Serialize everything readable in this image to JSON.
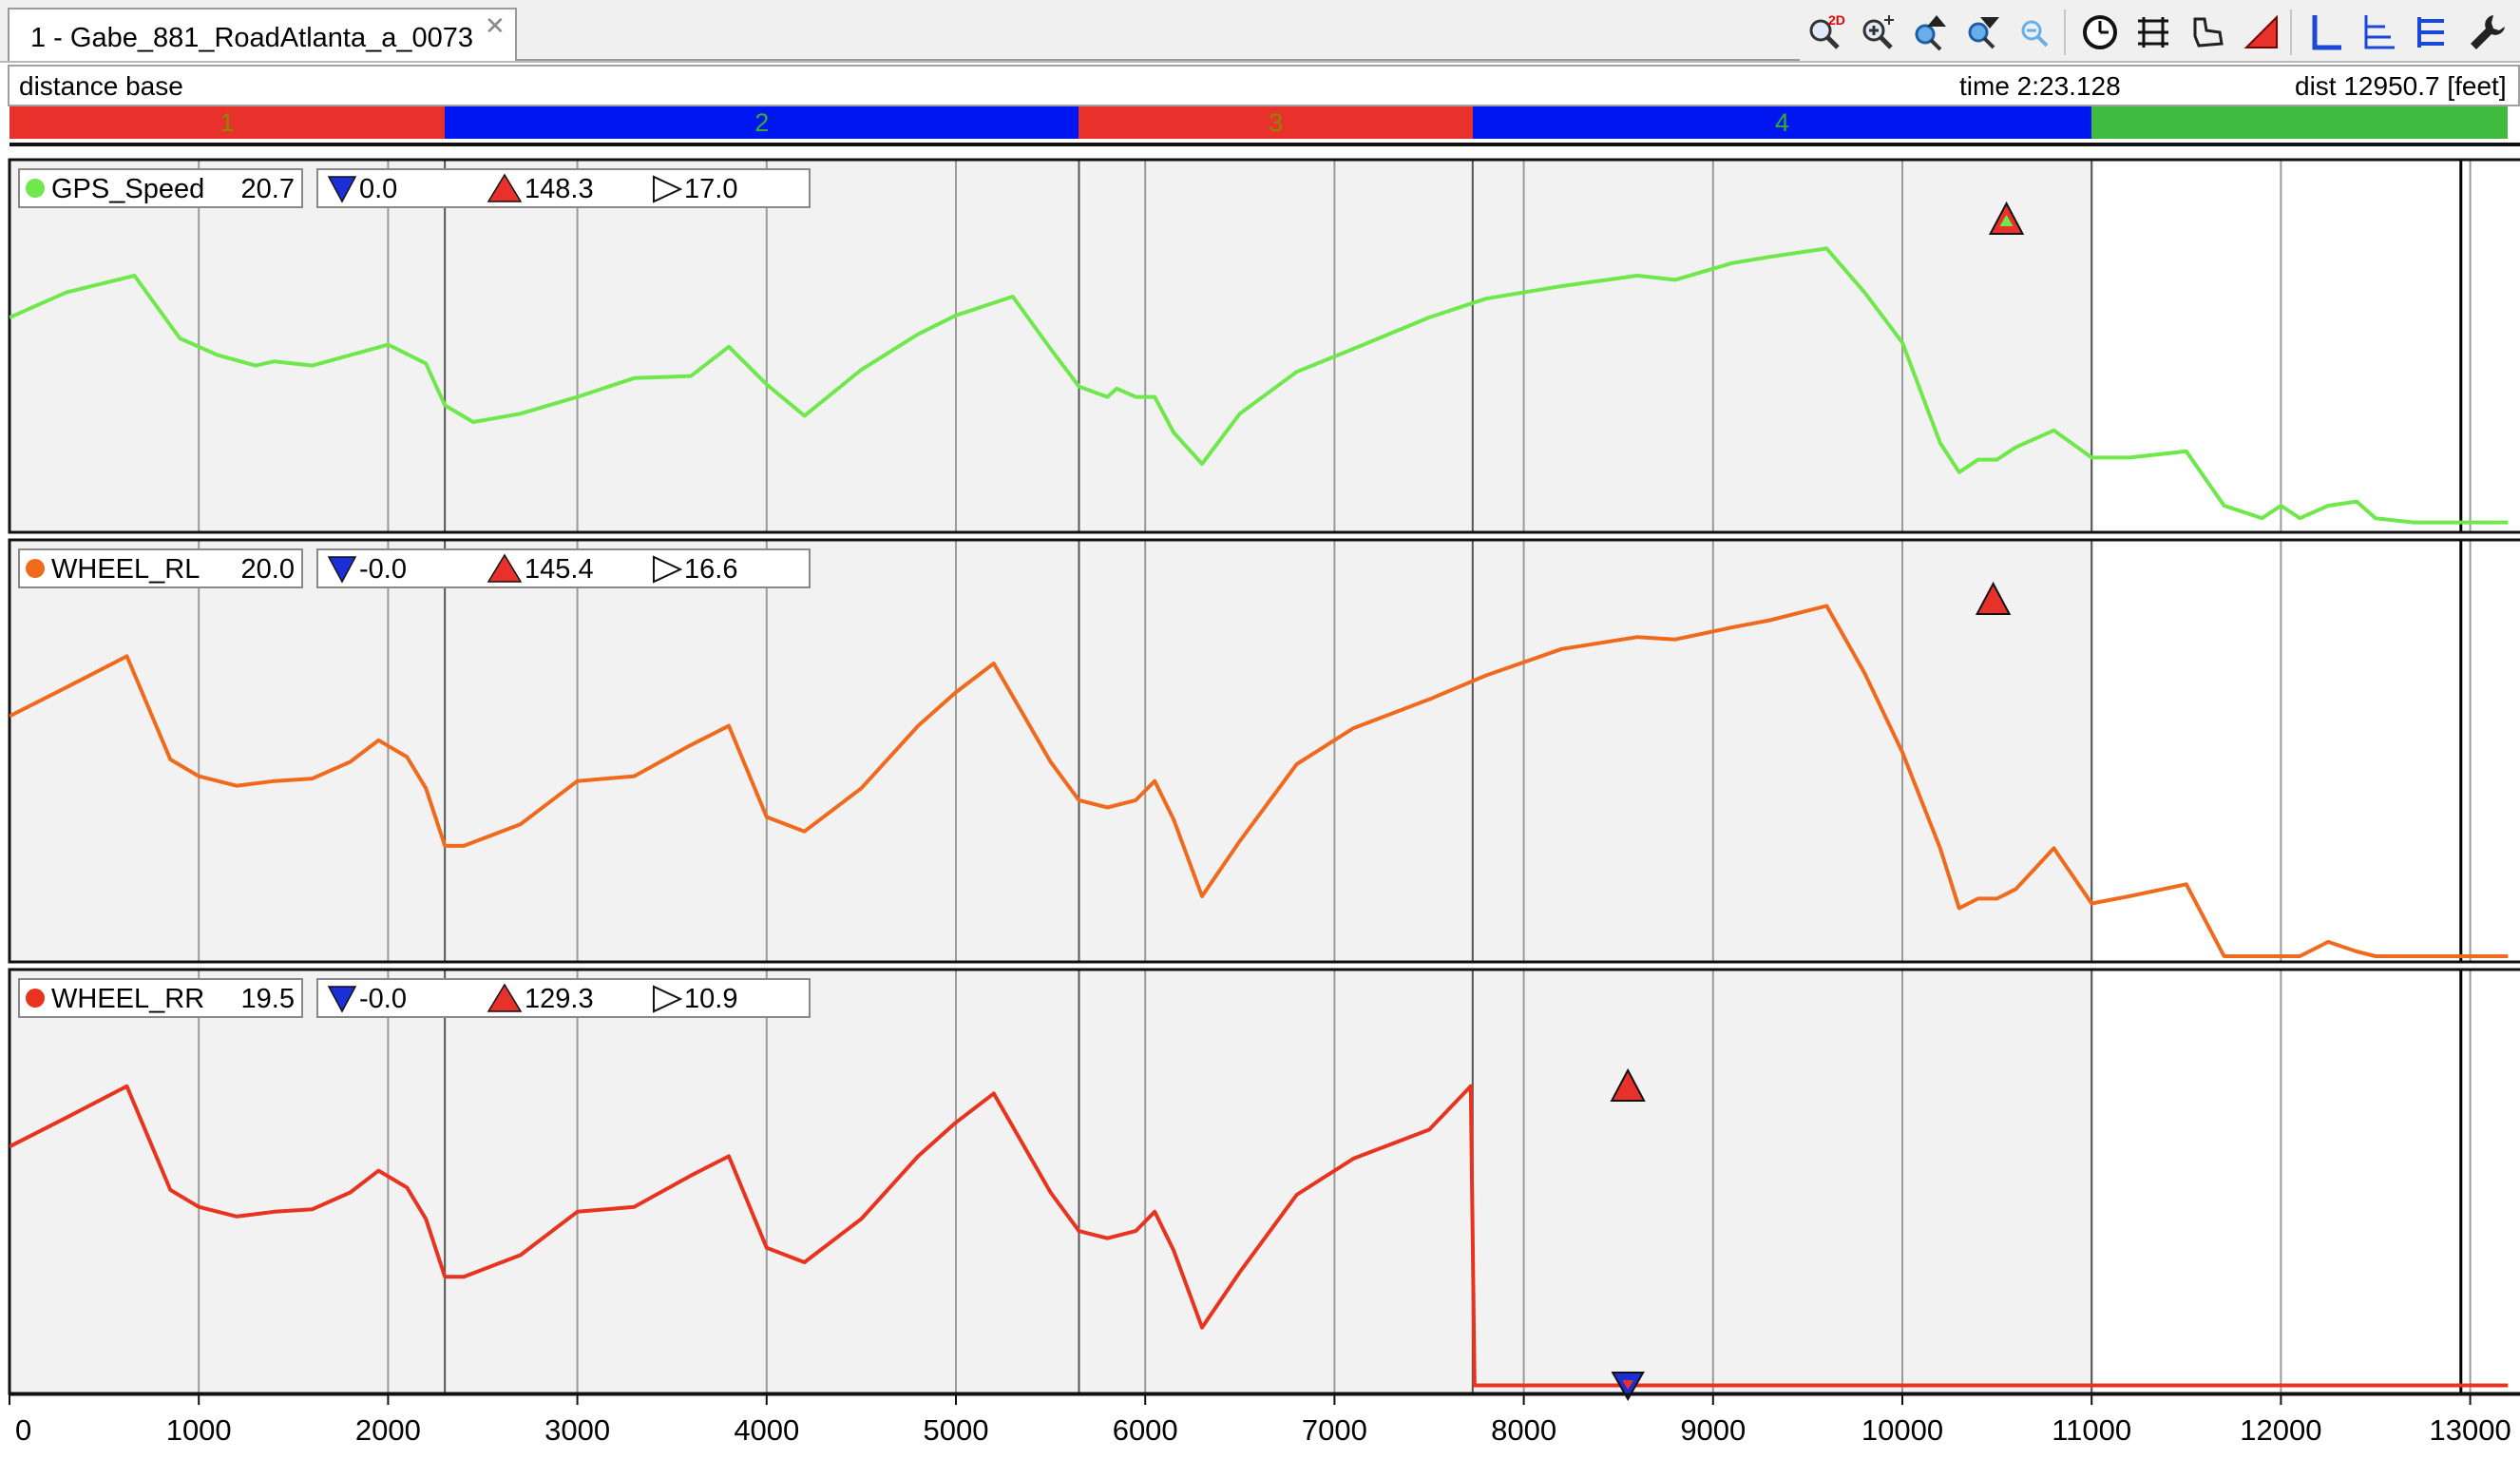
{
  "tab": {
    "title": "1 - Gabe_881_RoadAtlanta_a_0073",
    "close_glyph": "✕"
  },
  "toolbar": {
    "buttons": [
      {
        "icon": "zoom-2d-icon"
      },
      {
        "icon": "zoom-in-icon"
      },
      {
        "icon": "zoom-up-icon"
      },
      {
        "icon": "zoom-down-icon"
      },
      {
        "icon": "zoom-out-icon"
      },
      {
        "icon": "clock-icon"
      },
      {
        "icon": "ruler-icon"
      },
      {
        "icon": "track-map-icon"
      },
      {
        "icon": "triangle-icon"
      },
      {
        "icon": "axis-l-icon"
      },
      {
        "icon": "axis-stack-icon"
      },
      {
        "icon": "list-lines-icon"
      },
      {
        "icon": "wrench-icon"
      }
    ]
  },
  "info": {
    "mode": "distance base",
    "time": "time 2:23.128",
    "dist": "dist 12950.7 [feet]"
  },
  "colors": {
    "red": "#e8312a",
    "blue": "#0016f0",
    "green": "#3fbb3f",
    "segtext_red": "#8a8a00",
    "segtext_blue": "#2fb02f"
  },
  "chart_data": {
    "type": "line",
    "x_unit": "feet",
    "xlim": [
      0,
      13200
    ],
    "x_ticks": [
      0,
      1000,
      2000,
      3000,
      4000,
      5000,
      6000,
      7000,
      8000,
      9000,
      10000,
      11000,
      12000,
      13000
    ],
    "segments": [
      {
        "label": "1",
        "start": 0,
        "end": 2300,
        "color": "#e8312a"
      },
      {
        "label": "2",
        "start": 2300,
        "end": 5650,
        "color": "#0016f0"
      },
      {
        "label": "3",
        "start": 5650,
        "end": 7730,
        "color": "#e8312a"
      },
      {
        "label": "4",
        "start": 7730,
        "end": 11000,
        "color": "#0016f0"
      },
      {
        "label": "",
        "start": 11000,
        "end": 13200,
        "color": "#3fbb3f"
      }
    ],
    "section_lines": [
      2300,
      5650,
      7730,
      11000
    ],
    "cursor_x": 12950.7,
    "panels": [
      {
        "name": "GPS_Speed",
        "color": "#6ee84a",
        "value": "20.7",
        "min": "0.0",
        "max": "148.3",
        "avg": "17.0",
        "ylim": [
          0,
          160
        ],
        "max_marker_x": 10550,
        "x": [
          0,
          300,
          660,
          900,
          1100,
          1300,
          1400,
          1600,
          1800,
          2000,
          2200,
          2300,
          2450,
          2700,
          3000,
          3300,
          3600,
          3800,
          4000,
          4200,
          4500,
          4800,
          5000,
          5300,
          5500,
          5650,
          5800,
          5850,
          5950,
          6050,
          6150,
          6300,
          6500,
          6800,
          7100,
          7500,
          7800,
          8200,
          8600,
          8800,
          9100,
          9300,
          9600,
          9800,
          10000,
          10200,
          10300,
          10400,
          10500,
          10600,
          10800,
          11000,
          11200,
          11500,
          11700,
          11900,
          12000,
          12100,
          12250,
          12400,
          12500,
          12700,
          13200
        ],
        "y": [
          100,
          112,
          120,
          90,
          82,
          77,
          79,
          77,
          82,
          87,
          78,
          58,
          50,
          54,
          62,
          71,
          72,
          86,
          68,
          53,
          75,
          92,
          101,
          110,
          85,
          67,
          62,
          66,
          62,
          62,
          45,
          30,
          54,
          74,
          85,
          100,
          109,
          115,
          120,
          118,
          126,
          129,
          133,
          112,
          88,
          40,
          26,
          32,
          32,
          38,
          46,
          33,
          33,
          36,
          10,
          4,
          10,
          4,
          10,
          12,
          4,
          2,
          2
        ]
      },
      {
        "name": "WHEEL_RL",
        "color": "#f06a1e",
        "value": "20.0",
        "min": "-0.0",
        "max": "145.4",
        "avg": "16.6",
        "ylim": [
          0,
          160
        ],
        "max_marker_x": 10480,
        "x": [
          0,
          300,
          620,
          850,
          1000,
          1200,
          1400,
          1600,
          1800,
          1950,
          2100,
          2200,
          2300,
          2400,
          2700,
          3000,
          3300,
          3600,
          3800,
          4000,
          4200,
          4500,
          4800,
          5000,
          5200,
          5500,
          5650,
          5800,
          5950,
          6050,
          6150,
          6300,
          6500,
          6800,
          7100,
          7500,
          7800,
          8200,
          8600,
          8800,
          9100,
          9300,
          9600,
          9800,
          10000,
          10200,
          10300,
          10400,
          10500,
          10600,
          10800,
          11000,
          11200,
          11500,
          11700,
          11900,
          12000,
          12100,
          12250,
          12400,
          12500,
          12700,
          13200
        ],
        "y": [
          100,
          112,
          125,
          82,
          75,
          71,
          73,
          74,
          81,
          90,
          83,
          70,
          46,
          46,
          55,
          73,
          75,
          88,
          96,
          58,
          52,
          70,
          96,
          110,
          122,
          81,
          65,
          62,
          65,
          73,
          57,
          25,
          48,
          80,
          95,
          107,
          117,
          128,
          133,
          132,
          137,
          140,
          146,
          118,
          85,
          45,
          20,
          24,
          24,
          28,
          45,
          22,
          25,
          30,
          0,
          0,
          0,
          0,
          6,
          2,
          0,
          0,
          0
        ]
      },
      {
        "name": "WHEEL_RR",
        "color": "#e8331f",
        "value": "19.5",
        "min": "-0.0",
        "max": "129.3",
        "avg": "10.9",
        "ylim": [
          0,
          160
        ],
        "max_marker_x": 8550,
        "min_marker_x": 8550,
        "x": [
          0,
          300,
          620,
          850,
          1000,
          1200,
          1400,
          1600,
          1800,
          1950,
          2100,
          2200,
          2300,
          2400,
          2700,
          3000,
          3300,
          3600,
          3800,
          4000,
          4200,
          4500,
          4800,
          5000,
          5200,
          5500,
          5650,
          5800,
          5950,
          6050,
          6150,
          6300,
          6500,
          6800,
          7100,
          7500,
          7720,
          7740,
          13200
        ],
        "y": [
          100,
          112,
          125,
          82,
          75,
          71,
          73,
          74,
          81,
          90,
          83,
          70,
          46,
          46,
          55,
          73,
          75,
          88,
          96,
          58,
          52,
          70,
          96,
          110,
          122,
          81,
          65,
          62,
          65,
          73,
          57,
          25,
          48,
          80,
          95,
          107,
          125,
          1,
          1
        ]
      }
    ]
  }
}
